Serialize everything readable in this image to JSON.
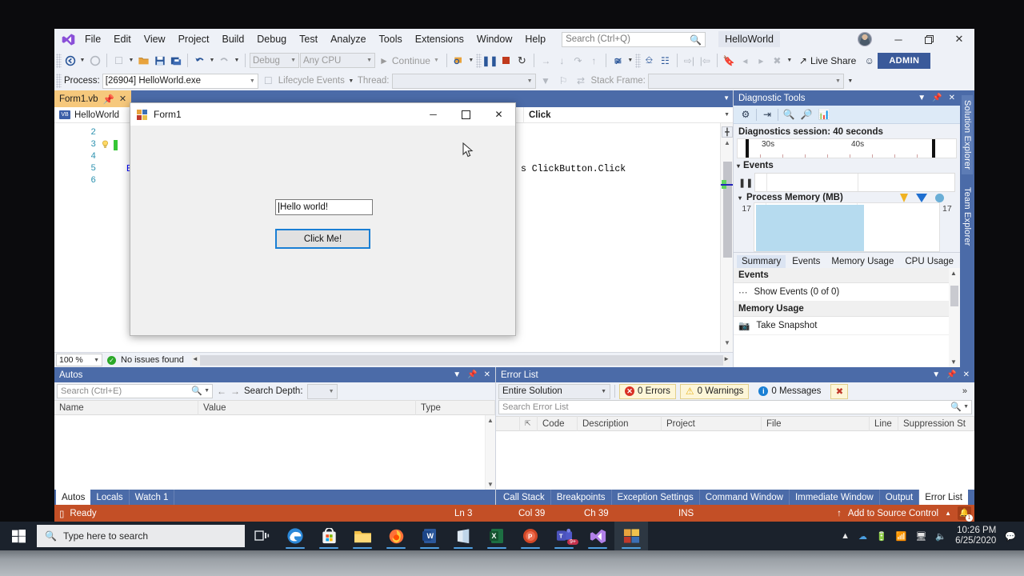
{
  "window": {
    "solution_name": "HelloWorld",
    "menu": [
      "File",
      "Edit",
      "View",
      "Project",
      "Build",
      "Debug",
      "Test",
      "Analyze",
      "Tools",
      "Extensions",
      "Window",
      "Help"
    ],
    "search_placeholder": "Search (Ctrl+Q)",
    "minimize": "─",
    "maximize": "❐",
    "close": "✕",
    "live_share": "Live Share",
    "admin_label": "ADMIN"
  },
  "toolbar": {
    "config": "Debug",
    "platform": "Any CPU",
    "continue": "Continue"
  },
  "process_toolbar": {
    "process_label": "Process:",
    "process_value": "[26904] HelloWorld.exe",
    "lifecycle_events": "Lifecycle Events",
    "thread_label": "Thread:",
    "thread_value": "",
    "stack_frame_label": "Stack Frame:",
    "stack_frame_value": ""
  },
  "editor": {
    "tab_label": "Form1.vb",
    "tab_close": "✕",
    "nav_project": "HelloWorld",
    "nav_project_badge": "VB",
    "nav_member": "Click",
    "line_numbers": [
      "2",
      "3",
      "4",
      "5",
      "6"
    ],
    "code_lines": [
      {
        "num": "2",
        "text": ""
      },
      {
        "num": "3",
        "text": ""
      },
      {
        "num": "4",
        "text": ""
      },
      {
        "num": "5",
        "text": "Er"
      },
      {
        "num": "6",
        "text": ""
      }
    ],
    "visible_code_right": "s ClickButton.Click",
    "zoom": "100 %",
    "issues": "No issues found"
  },
  "diagnostics": {
    "title": "Diagnostic Tools",
    "session": "Diagnostics session: 40 seconds",
    "ruler_labels": [
      "30s",
      "40s"
    ],
    "events_section": "Events",
    "memory_section": "Process Memory (MB)",
    "memory_left_value": "17",
    "memory_right_value": "17",
    "tabs": [
      "Summary",
      "Events",
      "Memory Usage",
      "CPU Usage"
    ],
    "active_tab": "Summary",
    "summary": [
      {
        "header": "Events",
        "row": "Show Events (0 of 0)",
        "icon": "events-icon"
      },
      {
        "header": "Memory Usage",
        "row": "Take Snapshot",
        "icon": "camera-icon"
      }
    ]
  },
  "side_tabs": [
    "Solution Explorer",
    "Team Explorer"
  ],
  "autos": {
    "title": "Autos",
    "search_placeholder": "Search (Ctrl+E)",
    "search_depth_label": "Search Depth:",
    "search_depth_value": "",
    "columns": [
      "Name",
      "Value",
      "Type"
    ],
    "rows": [],
    "tabs": [
      "Autos",
      "Locals",
      "Watch 1"
    ],
    "active_tab": "Autos"
  },
  "error_list": {
    "title": "Error List",
    "scope": "Entire Solution",
    "errors": "0 Errors",
    "warnings": "0 Warnings",
    "messages": "0 Messages",
    "search_placeholder": "Search Error List",
    "columns": [
      "",
      "",
      "Code",
      "Description",
      "Project",
      "File",
      "Line",
      "Suppression St"
    ],
    "rows": [],
    "tabs": [
      "Call Stack",
      "Breakpoints",
      "Exception Settings",
      "Command Window",
      "Immediate Window",
      "Output",
      "Error List"
    ],
    "active_tab": "Error List"
  },
  "status_bar": {
    "state": "Ready",
    "line": "Ln 3",
    "col": "Col 39",
    "ch": "Ch 39",
    "ins": "INS",
    "source_control": "Add to Source Control",
    "notification_count": "1"
  },
  "form1": {
    "title": "Form1",
    "minimize": "─",
    "maximize": "☐",
    "close": "✕",
    "textbox_value": "Hello world!",
    "button_label": "Click Me!"
  },
  "taskbar": {
    "search_placeholder": "Type here to search",
    "apps": [
      "task-view",
      "edge",
      "store",
      "file-explorer",
      "firefox",
      "word",
      "onenote",
      "excel",
      "powerpoint",
      "teams",
      "visual-studio",
      "form-app"
    ],
    "teams_badge": "9+",
    "time": "10:26 PM",
    "date": "6/25/2020"
  },
  "colors": {
    "vs_blue": "#4b6ba8",
    "accent": "#2a5699",
    "status_orange": "#c34f26",
    "tab_active": "#f6c87c",
    "admin": "#3a5a9a"
  }
}
